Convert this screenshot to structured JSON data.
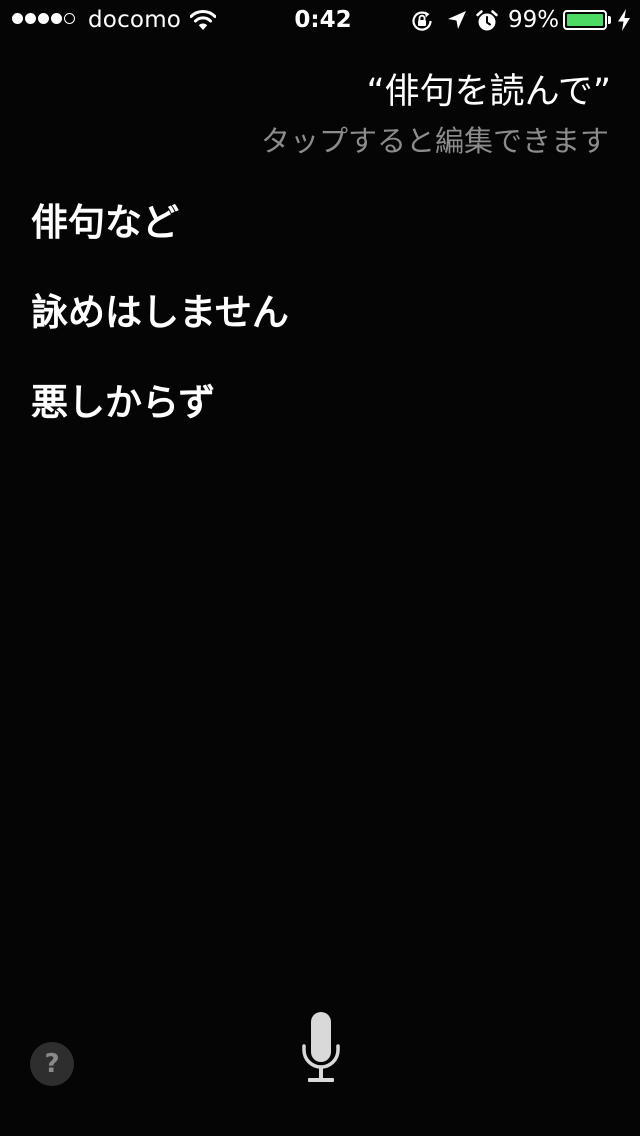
{
  "status_bar": {
    "carrier": "docomo",
    "signal_bars_filled": 4,
    "signal_bars_total": 5,
    "time": "0:42",
    "battery_percent_label": "99%",
    "battery_level": 0.99,
    "battery_color": "#4cd964",
    "icons": [
      "wifi-icon",
      "orientation-lock-icon",
      "location-arrow-icon",
      "alarm-icon",
      "battery-icon",
      "charging-bolt-icon"
    ]
  },
  "siri": {
    "query": "“俳句を読んで”",
    "tap_hint": "タップすると編集できます",
    "answer_lines": [
      "俳句など",
      "詠めはしません",
      "悪しからず"
    ]
  },
  "controls": {
    "help_label": "?",
    "mic_icon": "microphone-icon"
  },
  "colors": {
    "background": "#050505",
    "hint_text": "#8c8c8c",
    "help_button_bg": "#2e2e2e"
  }
}
